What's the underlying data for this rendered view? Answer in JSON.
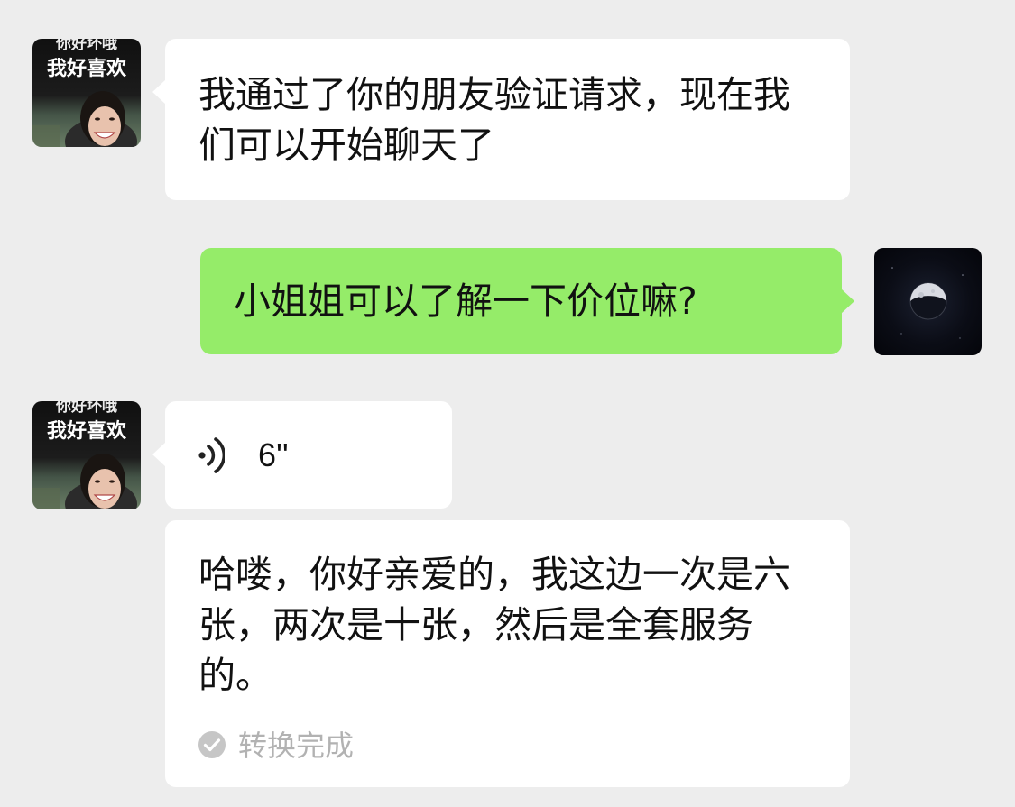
{
  "messages": [
    {
      "sender": "contact",
      "type": "text",
      "text": "我通过了你的朋友验证请求，现在我们可以开始聊天了"
    },
    {
      "sender": "self",
      "type": "text",
      "text": "小姐姐可以了解一下价位嘛?"
    },
    {
      "sender": "contact",
      "type": "voice",
      "duration": "6''",
      "transcript": "哈喽，你好亲爱的，我这边一次是六张，两次是十张，然后是全套服务的。",
      "transcript_status": "转换完成"
    }
  ],
  "contact_avatar": {
    "caption_line_1": "你好坏哦",
    "caption_line_2": "我好喜欢"
  },
  "colors": {
    "background": "#ededed",
    "incoming_bubble": "#ffffff",
    "outgoing_bubble": "#95ec69",
    "status_text": "#b2b2b2"
  },
  "icons": {
    "voice": "voice-wave-icon",
    "status": "check-circle-icon"
  }
}
